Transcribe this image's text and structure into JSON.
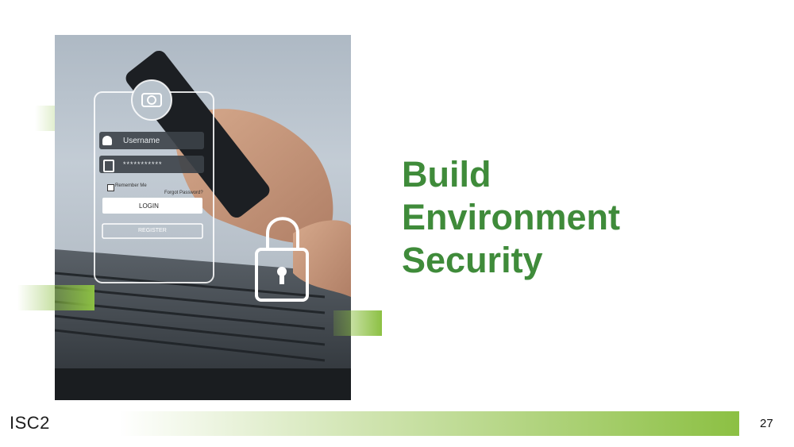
{
  "slide": {
    "title_lines": [
      "Build",
      "Environment",
      "Security"
    ],
    "page_number": "27",
    "logo_text": "ISC2"
  },
  "photo": {
    "login_card": {
      "username_label": "Username",
      "password_mask": "***********",
      "remember_me": "Remember Me",
      "forgot_password": "Forgot Password?",
      "login_label": "LOGIN",
      "register_label": "REGISTER"
    }
  },
  "colors": {
    "title_green": "#3f8b3a",
    "accent_green": "#8cc043"
  }
}
